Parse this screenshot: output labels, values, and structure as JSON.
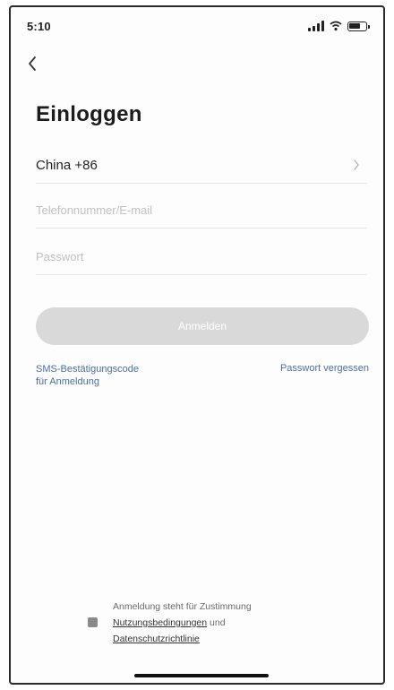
{
  "status_bar": {
    "time": "5:10"
  },
  "page": {
    "title": "Einloggen"
  },
  "form": {
    "country_label": "China +86",
    "phone_placeholder": "Telefonnummer/E-mail",
    "password_placeholder": "Passwort",
    "login_button_label": "Anmelden"
  },
  "links": {
    "sms_line1": "SMS-Bestätigungscode",
    "sms_line2": "für Anmeldung",
    "forgot_password": "Passwort vergessen"
  },
  "consent": {
    "line1": "Anmeldung steht für Zustimmung",
    "terms_link": "Nutzungsbedingungen",
    "and": " und",
    "privacy_link": "Datenschutzrichtlinie"
  },
  "colors": {
    "button_disabled": "#d9d9d9",
    "link": "#4a6fa5"
  }
}
